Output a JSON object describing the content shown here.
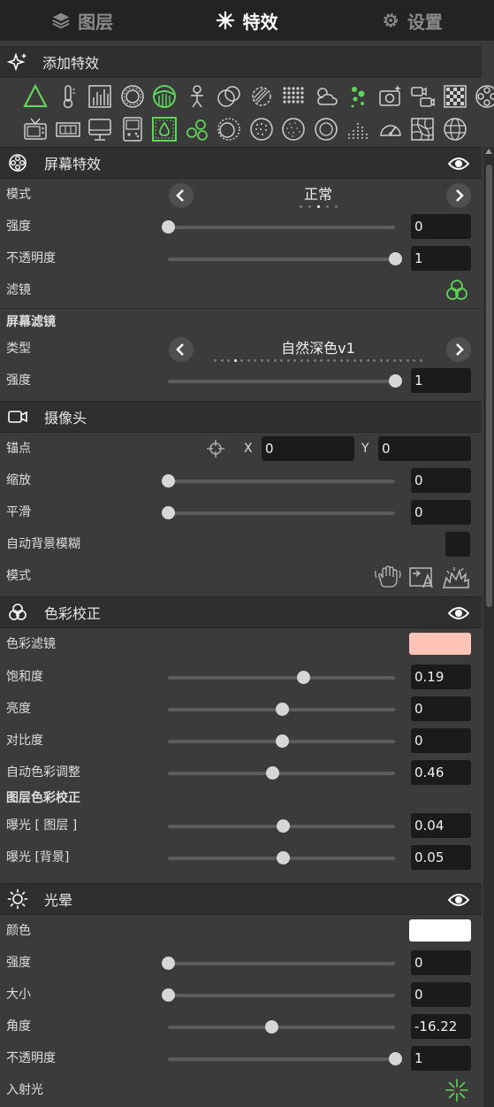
{
  "tabs": [
    {
      "label": "图层",
      "icon": "layers-icon"
    },
    {
      "label": "特效",
      "icon": "sparkle-icon"
    },
    {
      "label": "设置",
      "icon": "gear-icon"
    }
  ],
  "add_effects": {
    "title": "添加特效",
    "icon": "sparkle-add-icon"
  },
  "effect_icons": [
    "triangle-icon",
    "thermometer-icon",
    "bars-icon",
    "ring-icon",
    "half-sphere-icon",
    "person-icon",
    "overlap-circles-icon",
    "circle-hatch-icon",
    "dot-grid-icon",
    "cloud-sun-icon",
    "green-dots-icon",
    "camera-sparkle-icon",
    "video-switch-icon",
    "checker-grid-icon",
    "film-reel-icon",
    "tv-icon",
    "film-strip-icon",
    "monitor-icon",
    "handheld-icon",
    "water-drop-icon",
    "color-circles-icon",
    "swirl-circle-icon",
    "dotted-circle-icon",
    "noise-circle-icon",
    "ring-circle-icon",
    "dot-bars-icon",
    "speedometer-icon",
    "warp-grid-icon",
    "globe-grid-icon"
  ],
  "screen_effects": {
    "title": "屏幕特效",
    "mode_label": "模式",
    "mode_value": "正常",
    "strength_label": "强度",
    "strength_value": "0",
    "strength_level": 0,
    "opacity_label": "不透明度",
    "opacity_value": "1",
    "opacity_level": 1,
    "filter_label": "滤镜",
    "screen_filter_title": "屏幕滤镜",
    "type_label": "类型",
    "type_value": "自然深色v1",
    "filter_strength_label": "强度",
    "filter_strength_value": "1",
    "filter_strength_level": 1
  },
  "camera": {
    "title": "摄像头",
    "anchor_label": "锚点",
    "x_label": "X",
    "x_value": "0",
    "y_label": "Y",
    "y_value": "0",
    "zoom_label": "缩放",
    "zoom_value": "0",
    "zoom_level": 0,
    "smooth_label": "平滑",
    "smooth_value": "0",
    "smooth_level": 0,
    "auto_blur_label": "自动背景模糊",
    "mode_label": "模式"
  },
  "color_correction": {
    "title": "色彩校正",
    "filter_label": "色彩滤镜",
    "filter_color": "#ffc4b8",
    "saturation_label": "饱和度",
    "saturation_value": "0.19",
    "saturation_level": 0.595,
    "brightness_label": "亮度",
    "brightness_value": "0",
    "brightness_level": 0.5,
    "contrast_label": "对比度",
    "contrast_value": "0",
    "contrast_level": 0.5,
    "auto_color_label": "自动色彩调整",
    "auto_color_value": "0.46",
    "auto_color_level": 0.46,
    "layer_cc_title": "图层色彩校正",
    "exposure_layer_label": "曝光 [ 图层 ]",
    "exposure_layer_value": "0.04",
    "exposure_layer_level": 0.505,
    "exposure_bg_label": "曝光 [背景]",
    "exposure_bg_value": "0.05",
    "exposure_bg_level": 0.505
  },
  "halo": {
    "title": "光晕",
    "color_label": "颜色",
    "color_value": "#ffffff",
    "strength_label": "强度",
    "strength_value": "0",
    "strength_level": 0,
    "size_label": "大小",
    "size_value": "0",
    "size_level": 0,
    "angle_label": "角度",
    "angle_value": "-16.22",
    "angle_level": 0.455,
    "opacity_label": "不透明度",
    "opacity_value": "1",
    "opacity_level": 1,
    "incident_label": "入射光"
  },
  "colors": {
    "accent": "#5fd35a",
    "panel": "#3b3b3b",
    "header": "#2f2f2f",
    "topbar": "#232323",
    "input": "#1b1b1b"
  }
}
